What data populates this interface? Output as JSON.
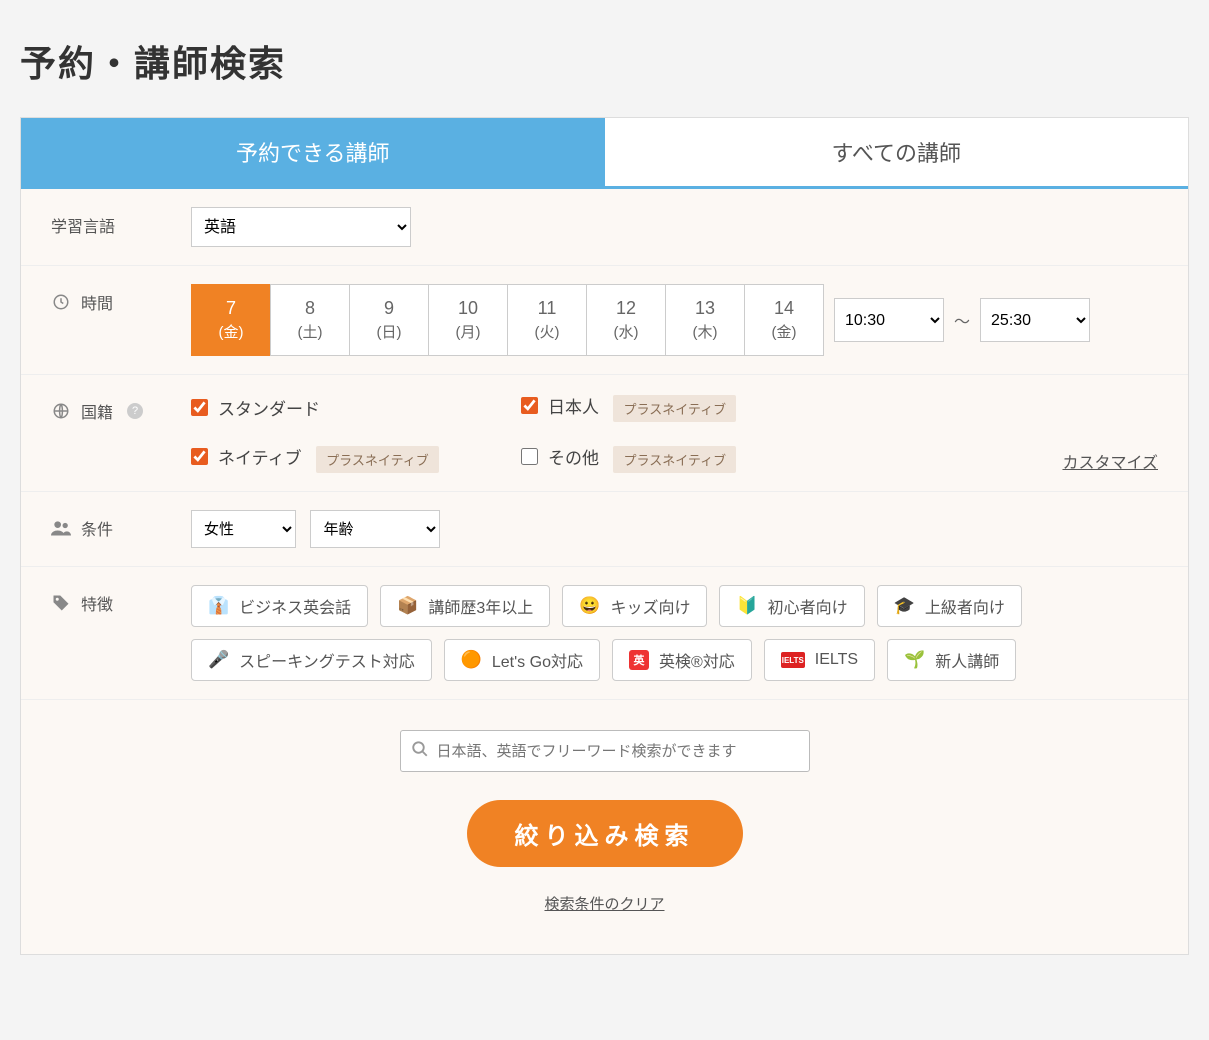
{
  "page_title": "予約・講師検索",
  "tabs": {
    "available": "予約できる講師",
    "all": "すべての講師"
  },
  "labels": {
    "language": "学習言語",
    "time": "時間",
    "nationality": "国籍",
    "condition": "条件",
    "feature": "特徴"
  },
  "language_select": "英語",
  "dates": [
    {
      "num": "7",
      "dow": "(金)",
      "active": true
    },
    {
      "num": "8",
      "dow": "(土)",
      "active": false
    },
    {
      "num": "9",
      "dow": "(日)",
      "active": false
    },
    {
      "num": "10",
      "dow": "(月)",
      "active": false
    },
    {
      "num": "11",
      "dow": "(火)",
      "active": false
    },
    {
      "num": "12",
      "dow": "(水)",
      "active": false
    },
    {
      "num": "13",
      "dow": "(木)",
      "active": false
    },
    {
      "num": "14",
      "dow": "(金)",
      "active": false
    }
  ],
  "time_from": "10:30",
  "time_to": "25:30",
  "time_sep": "～",
  "nationality": {
    "standard": "スタンダード",
    "native": "ネイティブ",
    "japanese": "日本人",
    "other": "その他",
    "plus_native_badge": "プラスネイティブ",
    "customize": "カスタマイズ"
  },
  "condition": {
    "gender": "女性",
    "age": "年齢"
  },
  "features": [
    {
      "id": "biz",
      "label": "ビジネス英会話",
      "emoji": "👔"
    },
    {
      "id": "exp3",
      "label": "講師歴3年以上",
      "emoji": "📦"
    },
    {
      "id": "kids",
      "label": "キッズ向け",
      "emoji": "😀"
    },
    {
      "id": "begin",
      "label": "初心者向け",
      "emoji": "🔰"
    },
    {
      "id": "adv",
      "label": "上級者向け",
      "emoji": "🎓"
    },
    {
      "id": "speak",
      "label": "スピーキングテスト対応",
      "emoji": "🎤"
    },
    {
      "id": "letsgo",
      "label": "Let's Go対応",
      "emoji": "🟠"
    },
    {
      "id": "eiken",
      "label": "英検®対応",
      "emoji": "英"
    },
    {
      "id": "ielts",
      "label": "IELTS",
      "emoji": "IELTS"
    },
    {
      "id": "new",
      "label": "新人講師",
      "emoji": "🌱"
    }
  ],
  "search_placeholder": "日本語、英語でフリーワード検索ができます",
  "search_button": "絞り込み検索",
  "clear_link": "検索条件のクリア"
}
